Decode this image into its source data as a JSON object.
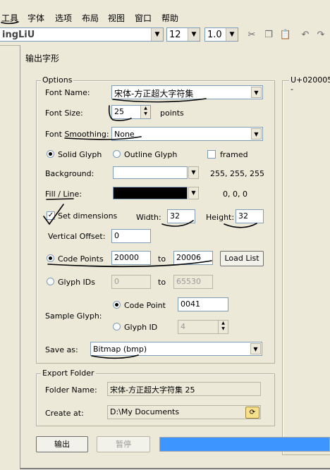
{
  "menu": [
    "工具",
    "字体",
    "选项",
    "布局",
    "视图",
    "窗口",
    "帮助"
  ],
  "toolbar": {
    "font_name": "ingLiU",
    "font_size": "12",
    "line_spacing": "1.0",
    "icons": [
      "cut-icon",
      "copy-icon",
      "paste-icon",
      "undo-icon",
      "redo-icon"
    ]
  },
  "dialog": {
    "title": "输出字形",
    "right_panel_label": "U+020005 -",
    "options": {
      "group_label": "Options",
      "font_name_label": "Font Name:",
      "font_name_value": "宋体-方正超大字符集",
      "font_size_label": "Font Size:",
      "font_size_value": "25",
      "font_size_unit": "points",
      "smoothing_label": "Font Smoothing:",
      "smoothing_value": "None",
      "solid_glyph": "Solid Glyph",
      "outline_glyph": "Outline Glyph",
      "framed": "framed",
      "background_label": "Background:",
      "background_rgb": "255, 255, 255",
      "background_color": "#ffffff",
      "fill_label": "Fill / Line:",
      "fill_rgb": "0, 0, 0",
      "fill_color": "#000000",
      "set_dimensions": "Set dimensions",
      "width_label": "Width:",
      "width_value": "32",
      "height_label": "Height:",
      "height_value": "32",
      "vertical_offset_label": "Vertical Offset:",
      "vertical_offset_value": "0",
      "code_points_label": "Code Points",
      "code_from": "20000",
      "to_label": "to",
      "code_to": "20006",
      "load_list": "Load List",
      "glyph_ids_label": "Glyph IDs",
      "glyph_from": "0",
      "glyph_to": "65530",
      "sample_glyph_label": "Sample Glyph:",
      "sample_code_point_label": "Code Point",
      "sample_code_point_value": "0041",
      "sample_glyph_id_label": "Glyph ID",
      "sample_glyph_id_value": "4",
      "save_as_label": "Save as:",
      "save_as_value": "Bitmap (bmp)"
    },
    "export": {
      "group_label": "Export Folder",
      "folder_name_label": "Folder Name:",
      "folder_name_value": "宋体-方正超大字符集 25",
      "create_at_label": "Create at:",
      "create_at_value": "D:\\My Documents"
    },
    "buttons": {
      "export": "输出",
      "pause": "暂停"
    },
    "progress": 1.0,
    "progress_color": "#3d95ff"
  }
}
